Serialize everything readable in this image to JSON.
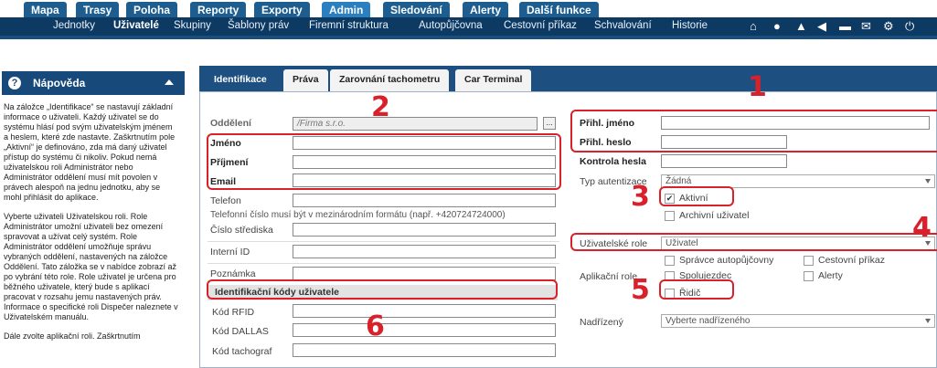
{
  "top_tabs": [
    {
      "label": "Mapa"
    },
    {
      "label": "Trasy"
    },
    {
      "label": "Poloha"
    },
    {
      "label": "Reporty"
    },
    {
      "label": "Exporty"
    },
    {
      "label": "Admin"
    },
    {
      "label": "Sledování"
    },
    {
      "label": "Alerty"
    },
    {
      "label": "Další funkce"
    }
  ],
  "subnav": [
    {
      "label": "Jednotky"
    },
    {
      "label": "Uživatelé"
    },
    {
      "label": "Skupiny"
    },
    {
      "label": "Šablony práv"
    },
    {
      "label": "Firemní struktura"
    },
    {
      "label": "Autopůjčovna"
    },
    {
      "label": "Cestovní příkaz"
    },
    {
      "label": "Schvalování"
    },
    {
      "label": "Historie"
    }
  ],
  "subnav_icons": [
    "home-icon",
    "chat-icon",
    "warning-icon",
    "sound-icon",
    "folder-icon",
    "mail-icon",
    "settings-icon",
    "power-icon"
  ],
  "help": {
    "title": "Nápověda",
    "p1": "Na záložce „Identifikace“ se nastavují základní informace o uživateli. Každý uživatel se do systému hlásí pod svým uživatelským jménem a heslem, které zde nastavte. Zaškrtnutím pole „Aktivní“ je definováno, zda má daný uživatel přístup do systému či nikoliv. Pokud nemá uživatelskou roli Administrátor nebo Administrátor oddělení musí mít povolen v právech alespoň na jednu jednotku, aby se mohl přihlásit do aplikace.",
    "p2": "Vyberte uživateli Uživatelskou roli. Role Administrátor umožní uživateli bez omezení spravovat a užívat celý systém. Role Administrátor oddělení umožňuje správu vybraných oddělení, nastavených na záložce Oddělení. Tato záložka se v nabídce zobrazí až po vybrání této role. Role uživatel je určena pro běžného uživatele, který bude s aplikací pracovat v rozsahu jemu nastavených práv. Informace o specifické roli Dispečer naleznete v Uživatelském manuálu.",
    "p3": "Dále zvolte aplikační roli. Zaškrtnutím"
  },
  "tabs": [
    {
      "label": "Identifikace"
    },
    {
      "label": "Práva"
    },
    {
      "label": "Zarovnání tachometru"
    },
    {
      "label": "Car Terminal"
    }
  ],
  "form": {
    "department_label": "Oddělení",
    "department_value": "/Firma s.r.o.",
    "dots": "...",
    "first_name_label": "Jméno",
    "last_name_label": "Příjmení",
    "email_label": "Email",
    "phone_label": "Telefon",
    "phone_note": "Telefonní číslo musí být v mezinárodním formátu (např. +420724724000)",
    "center_label": "Číslo střediska",
    "internal_id_label": "Interní ID",
    "note_label": "Poznámka",
    "codes_section": "Identifikační kódy uživatele",
    "rfid_label": "Kód RFID",
    "dallas_label": "Kód DALLAS",
    "tacho_label": "Kód tachograf",
    "login_label": "Přihl. jméno",
    "password_label": "Přihl. heslo",
    "password_check_label": "Kontrola hesla",
    "auth_type_label": "Typ autentizace",
    "auth_type_value": "Žádná",
    "active_label": "Aktivní",
    "active_checked": "✔",
    "archive_label": "Archivní uživatel",
    "user_role_label": "Uživatelské role",
    "user_role_value": "Uživatel",
    "app_role_label": "Aplikační role",
    "roles": {
      "rental_admin": "Správce autopůjčovny",
      "travel_order": "Cestovní příkaz",
      "co_driver": "Spolujezdec",
      "alerts": "Alerty",
      "driver": "Řidič"
    },
    "supervisor_label": "Nadřízený",
    "supervisor_value": "Vyberte nadřízeného"
  },
  "annotations": [
    "1",
    "2",
    "3",
    "4",
    "5",
    "6"
  ],
  "colors": {
    "nav_dark": "#0d3a63",
    "tab_blue": "#1d5d8f",
    "annotation_red": "#d8212a"
  }
}
